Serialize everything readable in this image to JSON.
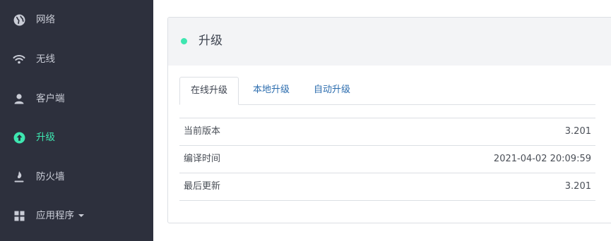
{
  "sidebar": {
    "items": [
      {
        "label": "网络",
        "icon": "globe-icon"
      },
      {
        "label": "无线",
        "icon": "wifi-icon"
      },
      {
        "label": "客户端",
        "icon": "user-icon"
      },
      {
        "label": "升级",
        "icon": "upgrade-arrow-icon",
        "active": true
      },
      {
        "label": "防火墙",
        "icon": "fire-icon"
      },
      {
        "label": "应用程序",
        "icon": "grid-icon",
        "has_dropdown": true
      }
    ]
  },
  "panel": {
    "title": "升级",
    "tabs": [
      {
        "label": "在线升级",
        "active": true
      },
      {
        "label": "本地升级"
      },
      {
        "label": "自动升级"
      }
    ],
    "rows": [
      {
        "key": "当前版本",
        "value": "3.201"
      },
      {
        "key": "编译时间",
        "value": "2021-04-02 20:09:59"
      },
      {
        "key": "最后更新",
        "value": "3.201"
      }
    ]
  },
  "colors": {
    "sidebar_bg": "#2d303d",
    "accent": "#3ee6b0",
    "link": "#2b6cae"
  }
}
